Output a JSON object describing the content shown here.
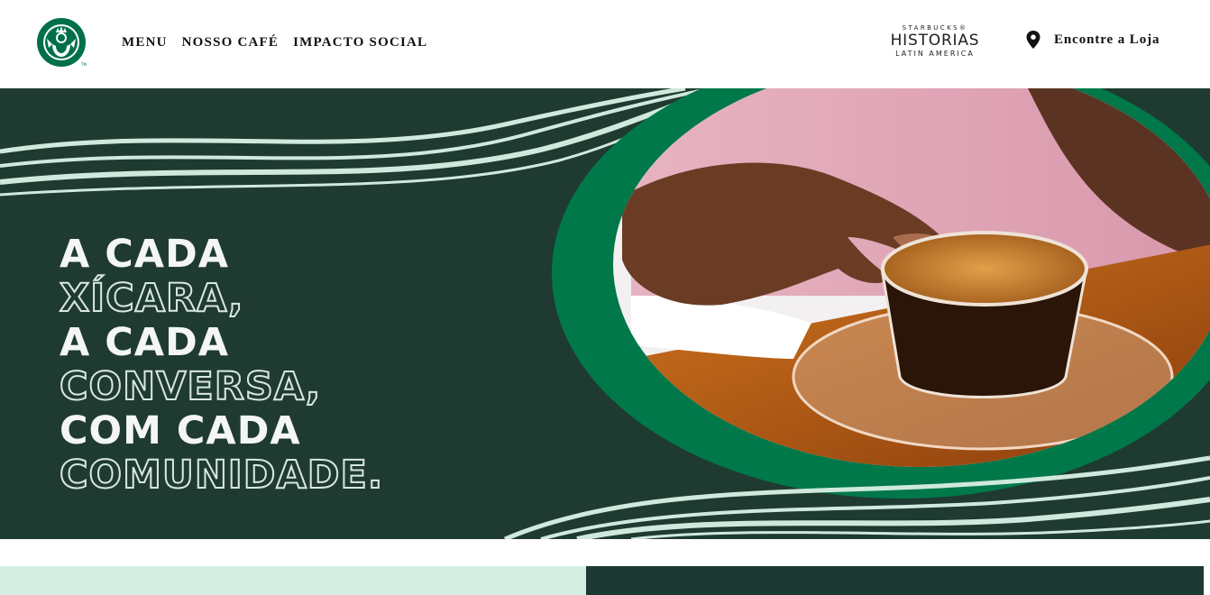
{
  "header": {
    "logo_icon": "starbucks-siren-logo-icon",
    "brand_color": "#00704A",
    "nav": [
      {
        "label": "MENU"
      },
      {
        "label": "NOSSO CAFÉ"
      },
      {
        "label": "IMPACTO SOCIAL"
      }
    ],
    "historias": {
      "top": "STARBUCKS®",
      "mid": "HISTORIAS",
      "bot": "LATIN AMERICA"
    },
    "store_link": {
      "icon": "location-pin-icon",
      "label": "Encontre a Loja"
    }
  },
  "hero": {
    "background_color": "#1f3a31",
    "ring_color": "#00784a",
    "lines": [
      {
        "text": "A CADA",
        "style": "solid"
      },
      {
        "text": "XÍCARA,",
        "style": "outline"
      },
      {
        "text": "A CADA",
        "style": "solid"
      },
      {
        "text": "CONVERSA,",
        "style": "outline"
      },
      {
        "text": "COM CADA",
        "style": "solid"
      },
      {
        "text": "COMUNIDADE.",
        "style": "outline"
      }
    ],
    "image_subject": "hand holding espresso cup on glass saucer"
  },
  "bottom": {
    "left_color": "#d4efe2",
    "right_color": "#1e3932"
  }
}
